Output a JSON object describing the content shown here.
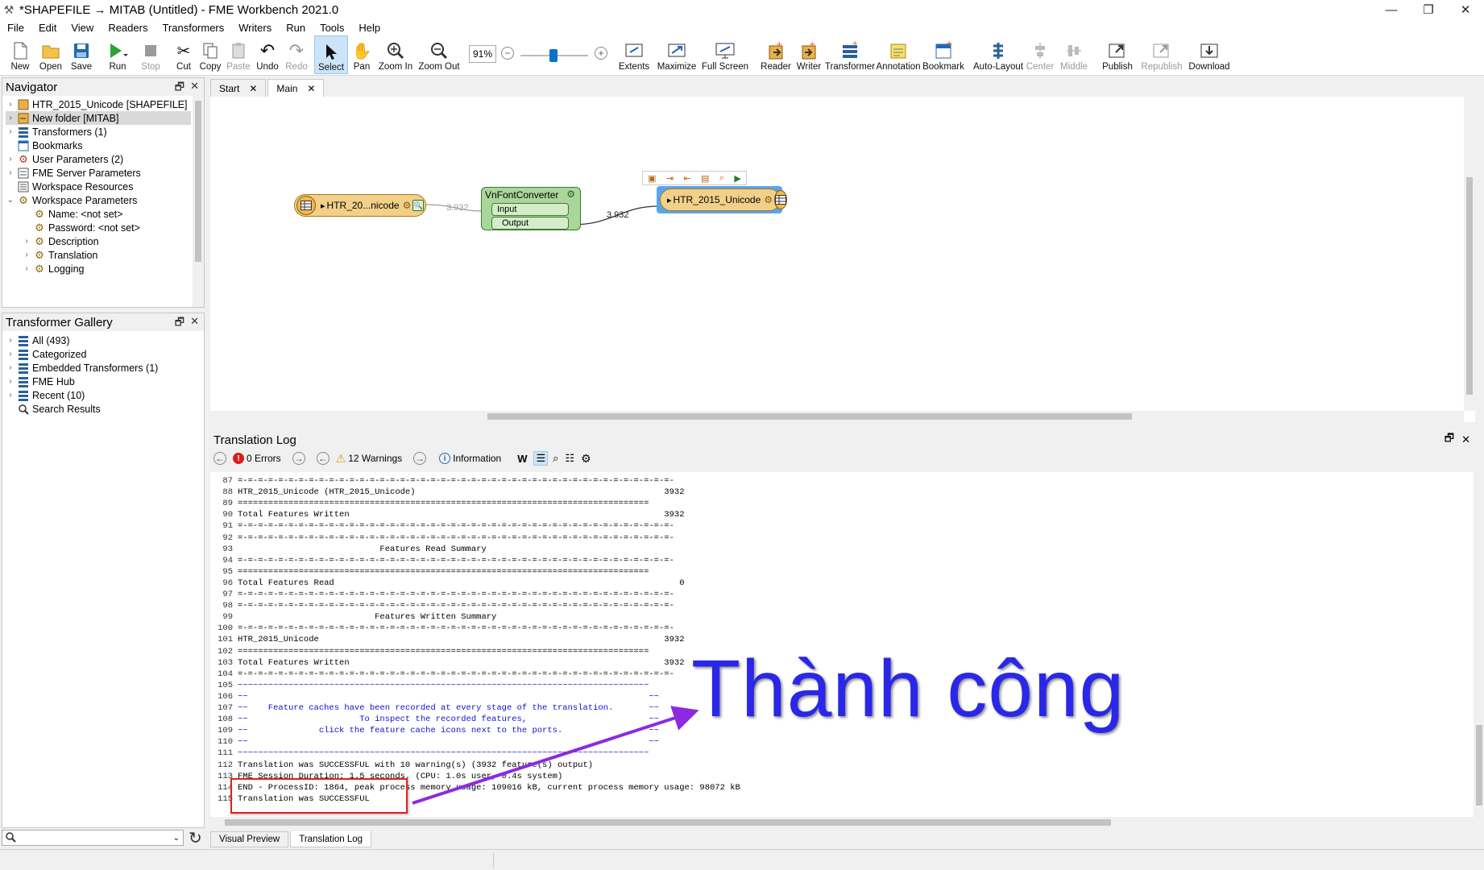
{
  "window": {
    "title": "*SHAPEFILE → MITAB (Untitled) - FME Workbench 2021.0",
    "minimize": "—",
    "restore": "❐",
    "close": "✕"
  },
  "menu": [
    "File",
    "Edit",
    "View",
    "Readers",
    "Transformers",
    "Writers",
    "Run",
    "Tools",
    "Help"
  ],
  "toolbar": {
    "new": "New",
    "open": "Open",
    "save": "Save",
    "run": "Run",
    "stop": "Stop",
    "cut": "Cut",
    "copy": "Copy",
    "paste": "Paste",
    "undo": "Undo",
    "redo": "Redo",
    "select": "Select",
    "pan": "Pan",
    "zoom_in": "Zoom In",
    "zoom_out": "Zoom Out",
    "zoom_level": "91%",
    "extents": "Extents",
    "maximize": "Maximize",
    "full_screen": "Full Screen",
    "reader": "Reader",
    "writer": "Writer",
    "transformer": "Transformer",
    "annotation": "Annotation",
    "bookmark": "Bookmark",
    "auto_layout": "Auto-Layout",
    "center": "Center",
    "middle": "Middle",
    "publish": "Publish",
    "republish": "Republish",
    "download": "Download"
  },
  "navigator": {
    "title": "Navigator",
    "items": [
      {
        "label": "HTR_2015_Unicode [SHAPEFILE]",
        "icon": "reader-icon"
      },
      {
        "label": "New folder [MITAB]",
        "icon": "writer-icon"
      },
      {
        "label": "Transformers (1)",
        "icon": "transformers-icon"
      },
      {
        "label": "Bookmarks",
        "icon": "bookmark-icon"
      },
      {
        "label": "User Parameters (2)",
        "icon": "gear-icon"
      },
      {
        "label": "FME Server Parameters",
        "icon": "server-icon"
      },
      {
        "label": "Workspace Resources",
        "icon": "resources-icon"
      },
      {
        "label": "Workspace Parameters",
        "icon": "gear-icon"
      },
      {
        "label": "Name: <not set>",
        "icon": "param-icon"
      },
      {
        "label": "Password: <not set>",
        "icon": "param-icon"
      },
      {
        "label": "Description",
        "icon": "param-icon"
      },
      {
        "label": "Translation",
        "icon": "param-icon"
      },
      {
        "label": "Logging",
        "icon": "param-icon"
      }
    ]
  },
  "gallery": {
    "title": "Transformer Gallery",
    "items": [
      {
        "label": "All (493)"
      },
      {
        "label": "Categorized"
      },
      {
        "label": "Embedded Transformers (1)"
      },
      {
        "label": "FME Hub"
      },
      {
        "label": "Recent (10)"
      },
      {
        "label": "Search Results"
      }
    ],
    "search_placeholder": ""
  },
  "tabs": {
    "start": "Start",
    "main": "Main"
  },
  "canvas": {
    "reader_label": "HTR_20...nicode",
    "reader_count": "3.932",
    "transformer_name": "VnFontConverter",
    "input_port": "Input",
    "output_port": "Output",
    "output_count": "3.932",
    "writer_label": "HTR_2015_Unicode"
  },
  "log": {
    "title": "Translation Log",
    "errors": "0 Errors",
    "warnings": "12 Warnings",
    "information": "Information",
    "lines": [
      {
        "n": "87",
        "t": "=-=-=-=-=-=-=-=-=-=-=-=-=-=-=-=-=-=-=-=-=-=-=-=-=-=-=-=-=-=-=-=-=-=-=-=-=-=-=-=-=-=-=-",
        "blue": false
      },
      {
        "n": "88",
        "t": "HTR_2015_Unicode (HTR_2015_Unicode)                                                 3932",
        "blue": false
      },
      {
        "n": "89",
        "t": "=================================================================================",
        "blue": false
      },
      {
        "n": "90",
        "t": "Total Features Written                                                              3932",
        "blue": false
      },
      {
        "n": "91",
        "t": "=-=-=-=-=-=-=-=-=-=-=-=-=-=-=-=-=-=-=-=-=-=-=-=-=-=-=-=-=-=-=-=-=-=-=-=-=-=-=-=-=-=-=-",
        "blue": false
      },
      {
        "n": "92",
        "t": "=-=-=-=-=-=-=-=-=-=-=-=-=-=-=-=-=-=-=-=-=-=-=-=-=-=-=-=-=-=-=-=-=-=-=-=-=-=-=-=-=-=-=-",
        "blue": false
      },
      {
        "n": "93",
        "t": "                            Features Read Summary",
        "blue": false
      },
      {
        "n": "94",
        "t": "=-=-=-=-=-=-=-=-=-=-=-=-=-=-=-=-=-=-=-=-=-=-=-=-=-=-=-=-=-=-=-=-=-=-=-=-=-=-=-=-=-=-=-",
        "blue": false
      },
      {
        "n": "95",
        "t": "=================================================================================",
        "blue": false
      },
      {
        "n": "96",
        "t": "Total Features Read                                                                    0",
        "blue": false
      },
      {
        "n": "97",
        "t": "=-=-=-=-=-=-=-=-=-=-=-=-=-=-=-=-=-=-=-=-=-=-=-=-=-=-=-=-=-=-=-=-=-=-=-=-=-=-=-=-=-=-=-",
        "blue": false
      },
      {
        "n": "98",
        "t": "=-=-=-=-=-=-=-=-=-=-=-=-=-=-=-=-=-=-=-=-=-=-=-=-=-=-=-=-=-=-=-=-=-=-=-=-=-=-=-=-=-=-=-",
        "blue": false
      },
      {
        "n": "99",
        "t": "                           Features Written Summary",
        "blue": false
      },
      {
        "n": "100",
        "t": "=-=-=-=-=-=-=-=-=-=-=-=-=-=-=-=-=-=-=-=-=-=-=-=-=-=-=-=-=-=-=-=-=-=-=-=-=-=-=-=-=-=-=-",
        "blue": false
      },
      {
        "n": "101",
        "t": "HTR_2015_Unicode                                                                    3932",
        "blue": false
      },
      {
        "n": "102",
        "t": "=================================================================================",
        "blue": false
      },
      {
        "n": "103",
        "t": "Total Features Written                                                              3932",
        "blue": false
      },
      {
        "n": "104",
        "t": "=-=-=-=-=-=-=-=-=-=-=-=-=-=-=-=-=-=-=-=-=-=-=-=-=-=-=-=-=-=-=-=-=-=-=-=-=-=-=-=-=-=-=-",
        "blue": false
      },
      {
        "n": "105",
        "t": "~~~~~~~~~~~~~~~~~~~~~~~~~~~~~~~~~~~~~~~~~~~~~~~~~~~~~~~~~~~~~~~~~~~~~~~~~~~~~~~~~",
        "blue": true
      },
      {
        "n": "106",
        "t": "~~                                                                               ~~",
        "blue": true
      },
      {
        "n": "107",
        "t": "~~    Feature caches have been recorded at every stage of the translation.       ~~",
        "blue": true
      },
      {
        "n": "108",
        "t": "~~                      To inspect the recorded features,                        ~~",
        "blue": true
      },
      {
        "n": "109",
        "t": "~~              click the feature cache icons next to the ports.                 ~~",
        "blue": true
      },
      {
        "n": "110",
        "t": "~~                                                                               ~~",
        "blue": true
      },
      {
        "n": "111",
        "t": "~~~~~~~~~~~~~~~~~~~~~~~~~~~~~~~~~~~~~~~~~~~~~~~~~~~~~~~~~~~~~~~~~~~~~~~~~~~~~~~~~",
        "blue": true
      },
      {
        "n": "112",
        "t": "Translation was SUCCESSFUL with 10 warning(s) (3932 feature(s) output)",
        "blue": false
      },
      {
        "n": "113",
        "t": "FME Session Duration: 1.5 seconds. (CPU: 1.0s user, 0.4s system)",
        "blue": false
      },
      {
        "n": "114",
        "t": "END - ProcessID: 1864, peak process memory usage: 109016 kB, current process memory usage: 98072 kB",
        "blue": false
      },
      {
        "n": "115",
        "t": "Translation was SUCCESSFUL",
        "blue": false
      }
    ]
  },
  "bottom_tabs": {
    "visual_preview": "Visual Preview",
    "translation_log": "Translation Log"
  },
  "annotation": {
    "text": "Thành công",
    "color": "#2a27e8",
    "arrow_color": "#8a2be2",
    "box_color": "#e32020"
  }
}
